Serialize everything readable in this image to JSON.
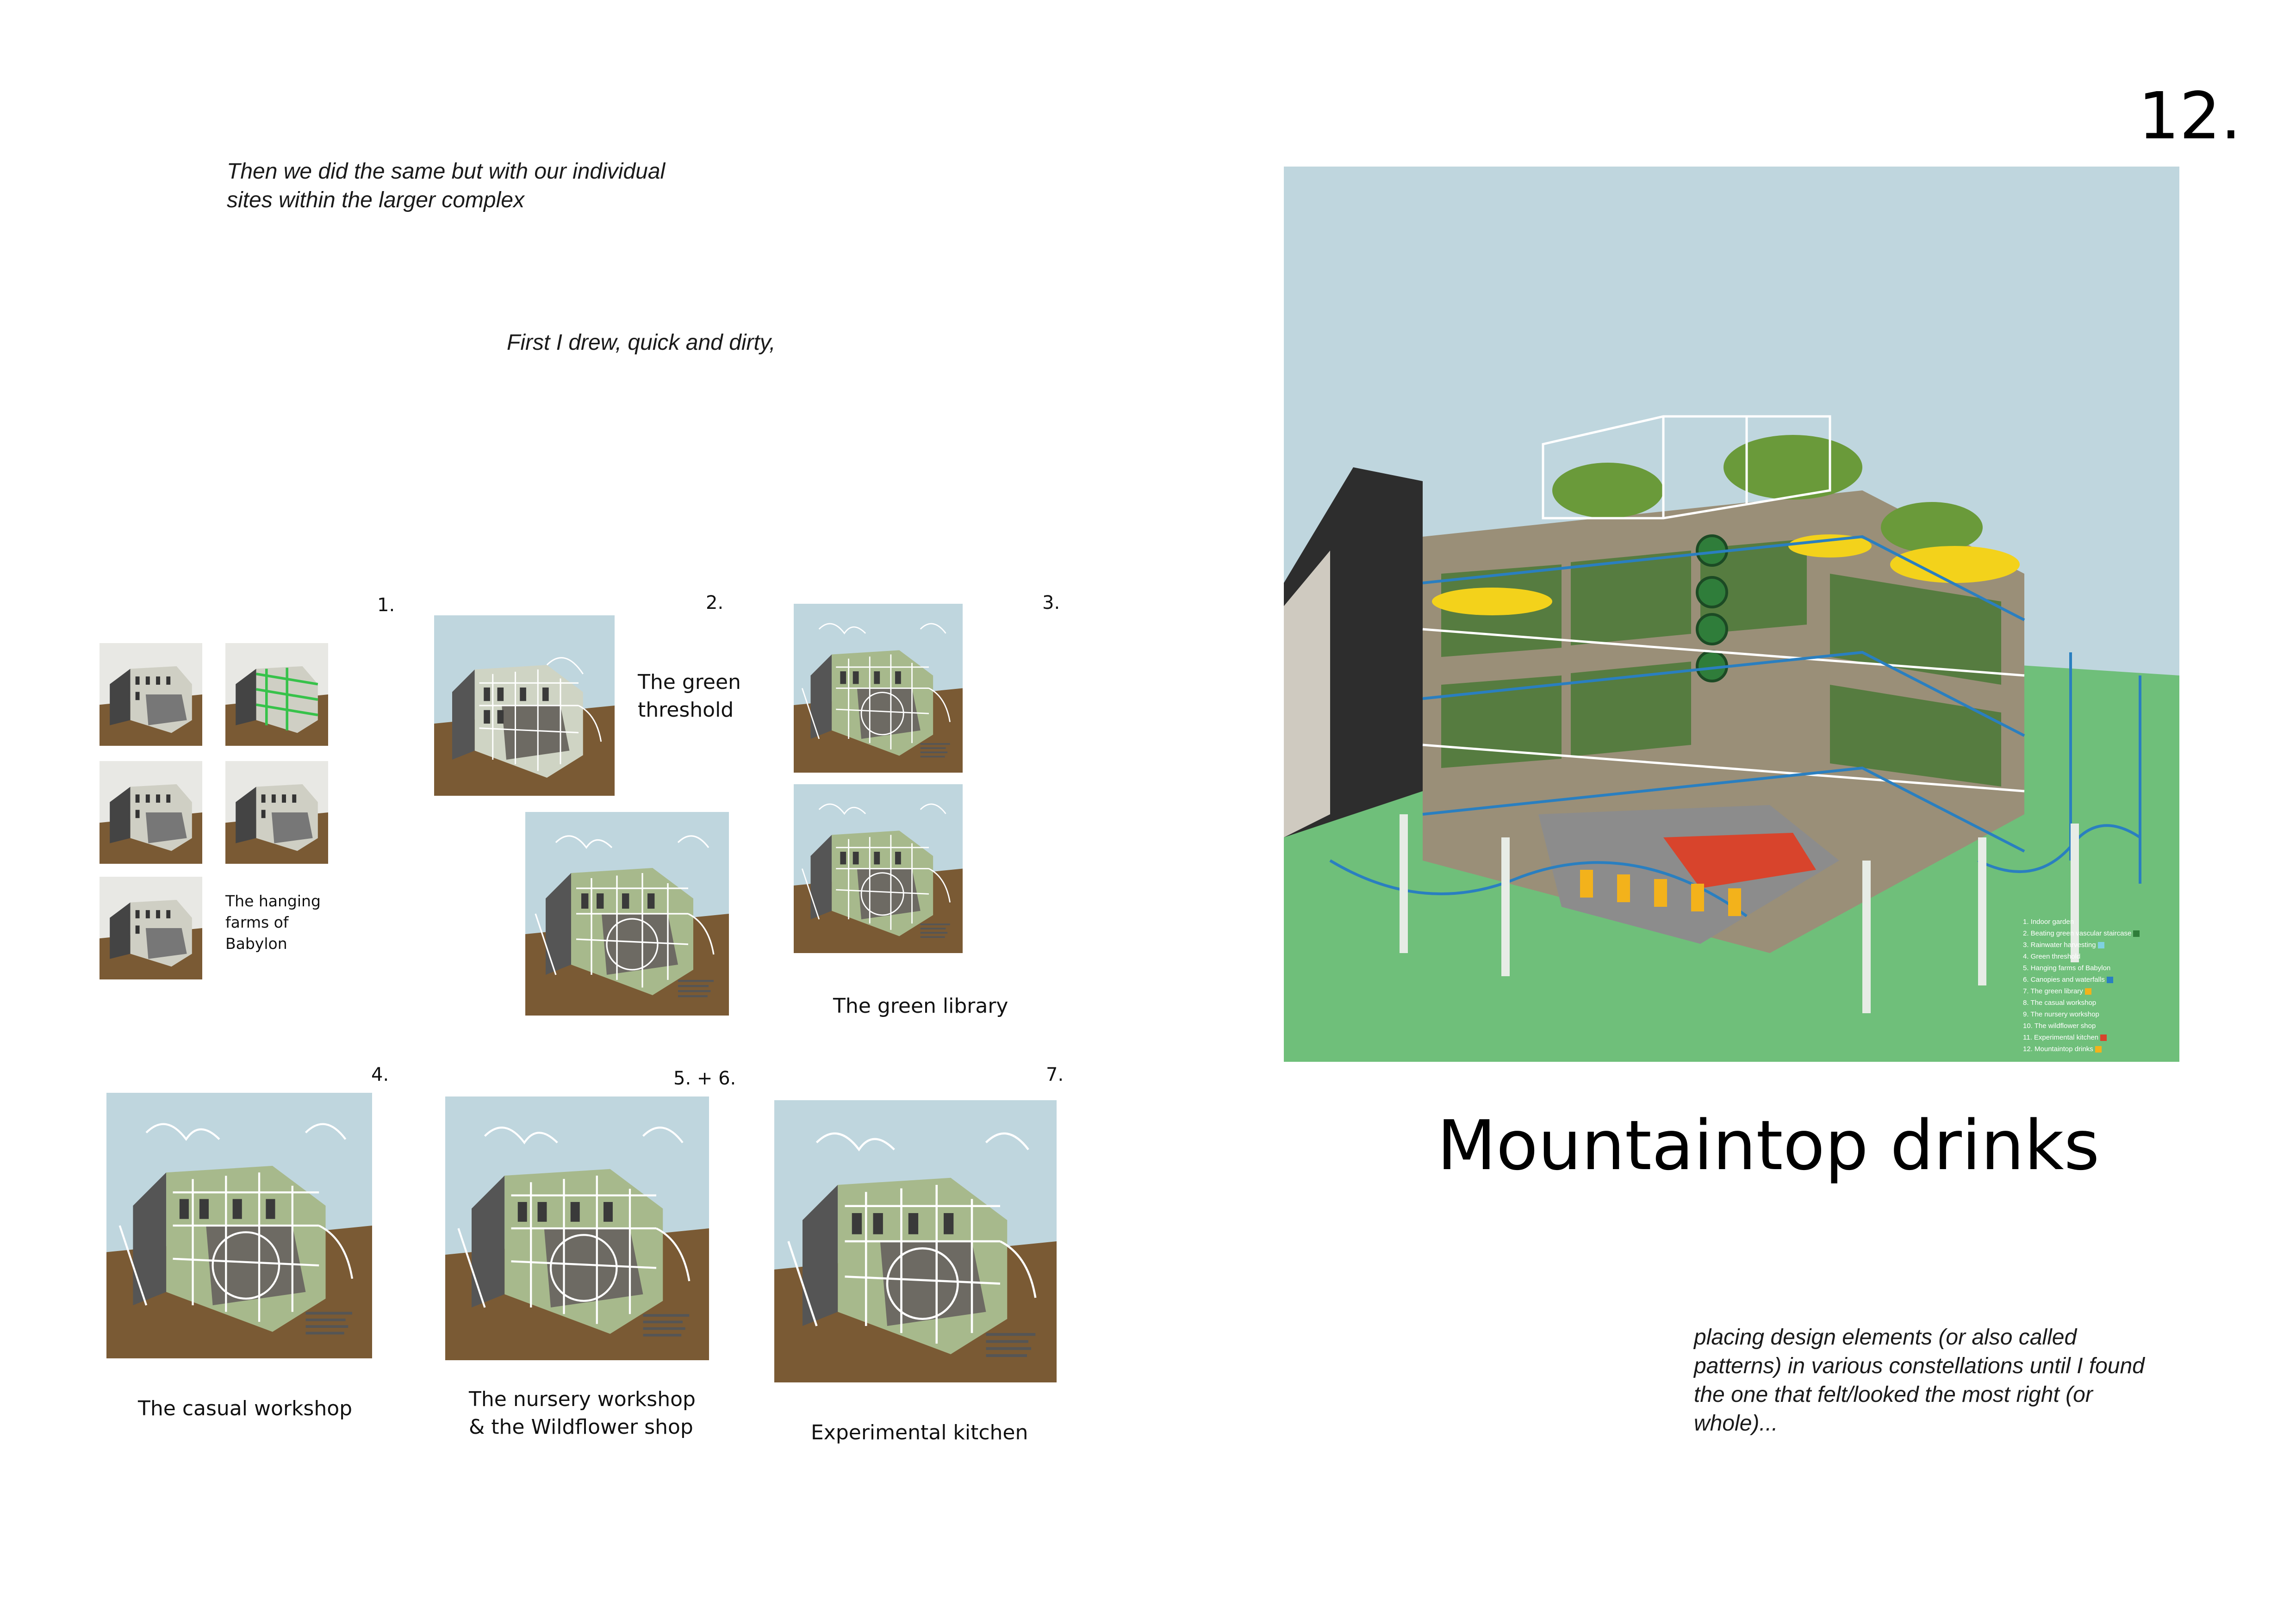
{
  "page_number": "12.",
  "intro_line1": "Then we did the same but with our individual",
  "intro_line2": "sites within the larger complex",
  "drew_note": "First I drew, quick and dirty,",
  "sections": {
    "s1": {
      "number": "1.",
      "label_line1": "The hanging",
      "label_line2": "farms of",
      "label_line3": "Babylon"
    },
    "s2": {
      "number": "2.",
      "label_line1": "The green",
      "label_line2": "threshold"
    },
    "s3": {
      "number": "3.",
      "label": "The green library"
    },
    "s4": {
      "number": "4.",
      "label": "The casual workshop"
    },
    "s56": {
      "number": "5. + 6.",
      "label_line1": "The nursery workshop",
      "label_line2": "& the Wildflower shop"
    },
    "s7": {
      "number": "7.",
      "label": "Experimental kitchen"
    }
  },
  "main_title": "Mountaintop drinks",
  "closing_note": {
    "line1": "placing design elements (or also called",
    "line2": "patterns) in various constellations until I found",
    "line3": "the one that felt/looked the most right (or",
    "line4": "whole)..."
  },
  "legend": [
    "1. Indoor garden",
    "2. Beating green vascular staircase",
    "3. Rainwater harvesting",
    "4. Green threshold",
    "5. Hanging farms of Babylon",
    "6. Canopies and waterfalls",
    "7. The green library",
    "8. The casual workshop",
    "9. The nursery workshop",
    "10. The wildflower shop",
    "11. Experimental kitchen",
    "12. Mountaintop drinks"
  ],
  "legend_colors": [
    "",
    "#2f7d3a",
    "#7fd1e0",
    "",
    "",
    "#2a7fc0",
    "#f3b21b",
    "",
    "",
    "#ffffff",
    "#d8442c",
    "#f3b21b"
  ],
  "colors": {
    "sky": "#bfd6de",
    "grass": "#6fbf7a",
    "ground_brown": "#7a5a34",
    "building_green": "#7a8f5c",
    "accent_yellow": "#f3d21b",
    "accent_red": "#d8442c",
    "accent_blue": "#2a7fc0"
  }
}
